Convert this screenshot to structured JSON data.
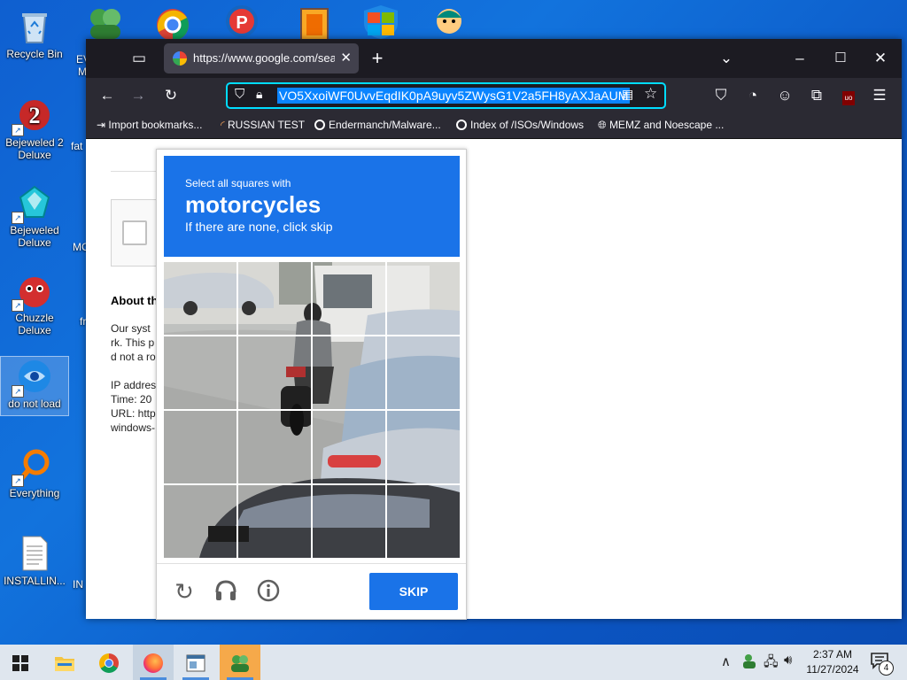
{
  "desktop": {
    "icons": [
      {
        "label": "Recycle Bin",
        "icon": "recycle-bin-icon"
      },
      {
        "label": "Bejeweled 2 Deluxe",
        "icon": "bejeweled2-icon"
      },
      {
        "label": "Bejeweled Deluxe",
        "icon": "bejeweled-icon"
      },
      {
        "label": "Chuzzle Deluxe",
        "icon": "chuzzle-icon"
      },
      {
        "label": "do not load",
        "icon": "thunderbird-icon"
      },
      {
        "label": "Everything",
        "icon": "everything-search-icon"
      },
      {
        "label": "INSTALLIN...",
        "icon": "text-document-icon"
      }
    ],
    "partial_labels": [
      "EV",
      "M",
      "fat",
      "MC",
      "fr",
      "IN"
    ]
  },
  "browser": {
    "tab_title": "https://www.google.com/searc",
    "url_display": "VO5XxoiWF0UvvEqdIK0pA9uyv5ZWysG1V2a5FH8yAXJaAUM",
    "bookmarks": [
      {
        "label": "Import bookmarks...",
        "icon": "import-icon"
      },
      {
        "label": "RUSSIAN TEST",
        "icon": "spinner-icon"
      },
      {
        "label": "Endermanch/Malware...",
        "icon": "github-icon"
      },
      {
        "label": "Index of /ISOs/Windows",
        "icon": "google-icon"
      },
      {
        "label": "MEMZ and Noescape ...",
        "icon": "globe-icon"
      }
    ],
    "page": {
      "about_heading": "About th",
      "lines": [
        "Our syst",
        "rk. This p",
        "d not a ro",
        "",
        "IP addres",
        "Time: 20",
        "URL: http",
        "windows-"
      ]
    }
  },
  "captcha": {
    "instruction_small": "Select all squares with",
    "target": "motorcycles",
    "instruction_sub": "If there are none, click skip",
    "skip_label": "SKIP",
    "grid_size": 4
  },
  "taskbar": {
    "time": "2:37 AM",
    "date": "11/27/2024",
    "notification_count": "4"
  }
}
